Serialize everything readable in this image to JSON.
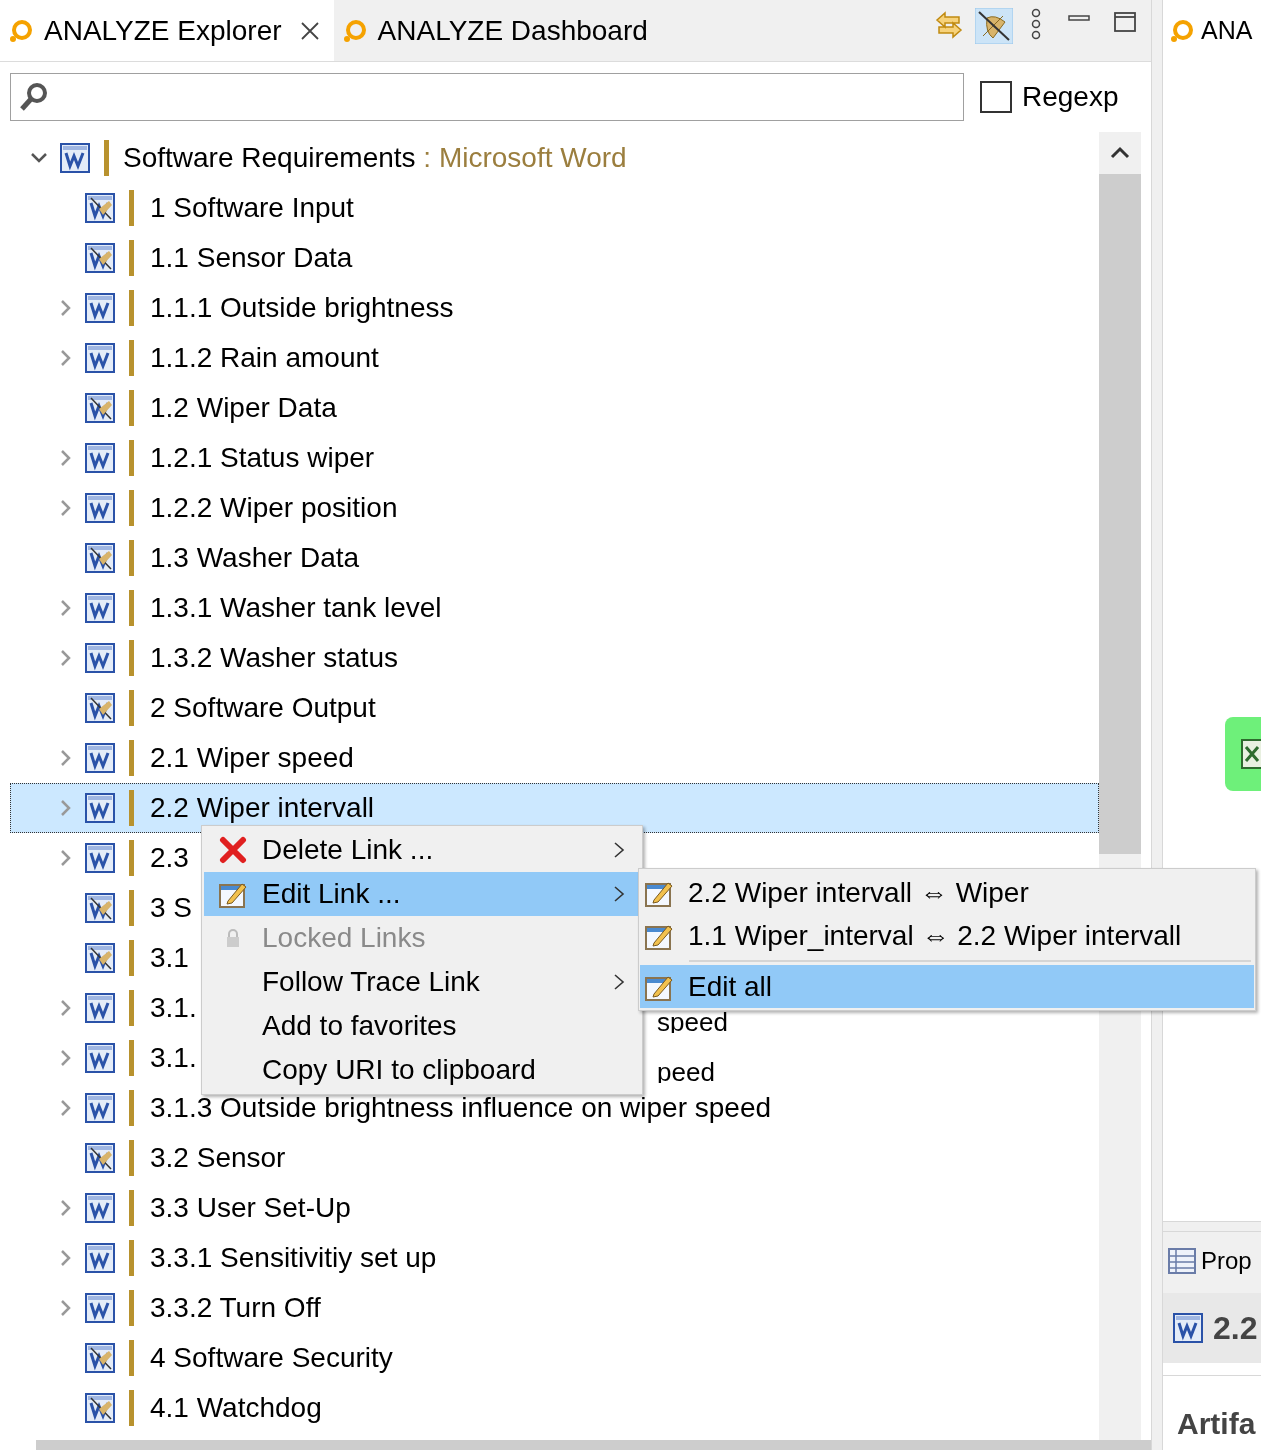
{
  "tabs": [
    {
      "label": "ANALYZE Explorer",
      "selected": true,
      "closable": true
    },
    {
      "label": "ANALYZE Dashboard",
      "selected": false,
      "closable": false
    }
  ],
  "toolbar": {
    "link_filter_on": true
  },
  "search": {
    "regexp_label": "Regexp",
    "regexp_checked": false
  },
  "tree": {
    "label": "Software Requirements",
    "suffix": " : Microsoft Word",
    "expanded": true,
    "children": [
      {
        "label": "1 Software Input",
        "kind": "heading",
        "expandable": false,
        "selected": false
      },
      {
        "label": "1.1 Sensor Data",
        "kind": "heading",
        "expandable": false,
        "selected": false
      },
      {
        "label": "1.1.1 Outside brightness",
        "kind": "document",
        "expandable": true,
        "selected": false
      },
      {
        "label": "1.1.2 Rain amount",
        "kind": "document",
        "expandable": true,
        "selected": false
      },
      {
        "label": "1.2 Wiper Data",
        "kind": "heading",
        "expandable": false,
        "selected": false
      },
      {
        "label": "1.2.1 Status wiper",
        "kind": "document",
        "expandable": true,
        "selected": false
      },
      {
        "label": "1.2.2 Wiper position",
        "kind": "document",
        "expandable": true,
        "selected": false
      },
      {
        "label": "1.3 Washer Data",
        "kind": "heading",
        "expandable": false,
        "selected": false
      },
      {
        "label": "1.3.1 Washer tank level",
        "kind": "document",
        "expandable": true,
        "selected": false
      },
      {
        "label": "1.3.2 Washer status",
        "kind": "document",
        "expandable": true,
        "selected": false
      },
      {
        "label": "2 Software Output",
        "kind": "heading",
        "expandable": false,
        "selected": false
      },
      {
        "label": "2.1 Wiper speed",
        "kind": "document",
        "expandable": true,
        "selected": false
      },
      {
        "label": "2.2 Wiper intervall",
        "kind": "document",
        "expandable": true,
        "selected": true
      },
      {
        "label": "2.3",
        "kind": "document",
        "expandable": true,
        "selected": false
      },
      {
        "label": "3 S",
        "kind": "heading",
        "expandable": false,
        "selected": false
      },
      {
        "label": "3.1",
        "kind": "heading",
        "expandable": false,
        "selected": false
      },
      {
        "label": "3.1.",
        "tail": "speed",
        "kind": "document",
        "expandable": true,
        "selected": false
      },
      {
        "label": "3.1.",
        "tail": "peed",
        "kind": "document",
        "expandable": true,
        "selected": false
      },
      {
        "label": "3.1.3 Outside brightness influence on wiper speed",
        "kind": "document",
        "expandable": true,
        "selected": false
      },
      {
        "label": "3.2 Sensor",
        "kind": "heading",
        "expandable": false,
        "selected": false
      },
      {
        "label": "3.3 User Set-Up",
        "kind": "document",
        "expandable": true,
        "selected": false
      },
      {
        "label": "3.3.1 Sensitivitiy set up",
        "kind": "document",
        "expandable": true,
        "selected": false
      },
      {
        "label": "3.3.2 Turn Off",
        "kind": "document",
        "expandable": true,
        "selected": false
      },
      {
        "label": "4 Software Security",
        "kind": "heading",
        "expandable": false,
        "selected": false
      },
      {
        "label": "4.1 Watchdog",
        "kind": "heading",
        "expandable": false,
        "selected": false
      }
    ]
  },
  "context_menu": [
    {
      "label": "Delete Link ...",
      "kind": "delete",
      "submenu": true,
      "disabled": false,
      "selected": false
    },
    {
      "label": "Edit Link ...",
      "kind": "edit",
      "submenu": true,
      "disabled": false,
      "selected": true
    },
    {
      "label": "Locked Links",
      "kind": "locked",
      "submenu": false,
      "disabled": true,
      "selected": false
    },
    {
      "label": "Follow Trace Link",
      "kind": "plain",
      "submenu": true,
      "disabled": false,
      "selected": false
    },
    {
      "label": "Add to favorites",
      "kind": "plain",
      "submenu": false,
      "disabled": false,
      "selected": false
    },
    {
      "label": "Copy URI to clipboard",
      "kind": "plain",
      "submenu": false,
      "disabled": false,
      "selected": false
    }
  ],
  "submenu": [
    {
      "label": "2.2 Wiper intervall ⇔ Wiper",
      "separator_before": false,
      "selected": false
    },
    {
      "label": "1.1 Wiper_interval ⇔ 2.2 Wiper intervall",
      "separator_before": false,
      "selected": false
    },
    {
      "label": "Edit all",
      "separator_before": true,
      "selected": true
    }
  ],
  "right_panel": {
    "tab": "ANA",
    "properties_tab": "Prop",
    "properties_title": "2.2",
    "section": "Artifa"
  }
}
